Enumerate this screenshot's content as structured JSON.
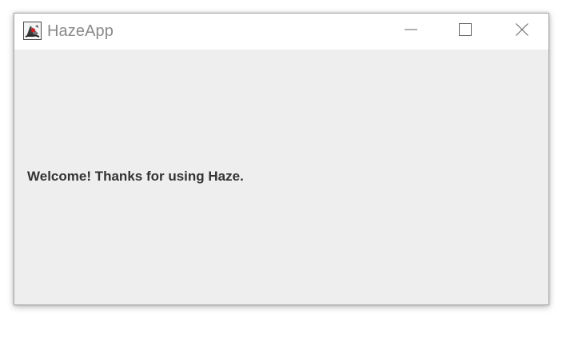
{
  "window": {
    "title": "HazeApp",
    "icon": "java-duke-icon",
    "controls": {
      "minimize_icon": "minimize-icon",
      "maximize_icon": "maximize-icon",
      "close_icon": "close-icon"
    }
  },
  "content": {
    "welcome_text": "Welcome! Thanks for using Haze."
  },
  "colors": {
    "titlebar_background": "#ffffff",
    "content_background": "#eeeeee",
    "title_text": "#8a8a8a",
    "body_text": "#333333"
  }
}
